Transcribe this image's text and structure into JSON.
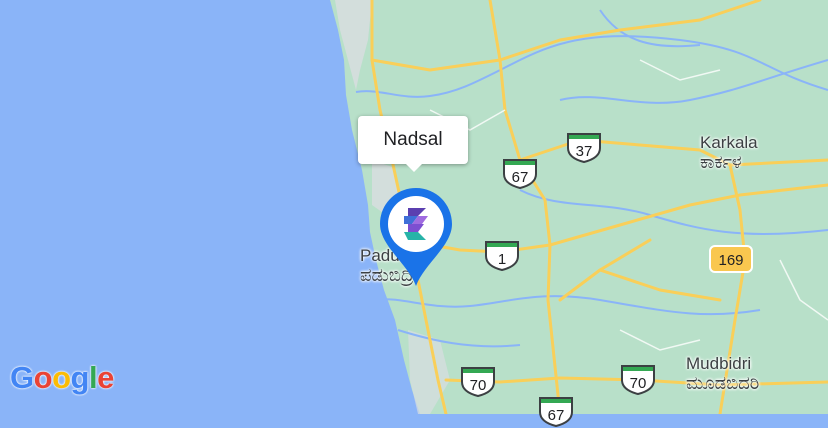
{
  "map": {
    "colors": {
      "water": "#8ab4f8",
      "land": "#b8e0c9",
      "road": "#fdd663",
      "pin": "#1a73e8"
    },
    "selected_place": "Nadsal",
    "marker_icon": "brand-logo-icon",
    "places": {
      "karkala": {
        "name": "Karkala",
        "local": "ಕಾರ್ಕಳ"
      },
      "padubidri": {
        "name": "Padubidri",
        "local": "ಪಡುಬಿದ್ರಿ"
      },
      "mudbidri": {
        "name": "Mudbidri",
        "local": "ಮೂಡಬಿದರಿ"
      }
    },
    "routes": {
      "r37": "37",
      "r67a": "67",
      "r1": "1",
      "r169": "169",
      "r70a": "70",
      "r70b": "70",
      "r67b": "67"
    },
    "attribution": {
      "letters": [
        "G",
        "o",
        "o",
        "g",
        "l",
        "e"
      ],
      "colors": [
        "#4285f4",
        "#ea4335",
        "#fbbc05",
        "#4285f4",
        "#34a853",
        "#ea4335"
      ]
    }
  }
}
